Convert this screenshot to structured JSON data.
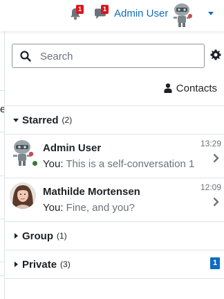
{
  "navbar": {
    "notification_count": "1",
    "message_count": "1",
    "user_name": "Admin User"
  },
  "drawer": {
    "search": {
      "placeholder": "Search",
      "value": ""
    },
    "contacts_label": "Contacts",
    "page_glyph": "e",
    "sections": {
      "starred": {
        "label": "Starred",
        "count": "(2)",
        "conversations": [
          {
            "name": "Admin User",
            "prefix": "You:",
            "message": "This is a self-conversation 1",
            "time": "13:29",
            "status": "online"
          },
          {
            "name": "Mathilde Mortensen",
            "prefix": "You:",
            "message": "Fine, and you?",
            "time": "12:09"
          }
        ]
      },
      "group": {
        "label": "Group",
        "count": "(1)"
      },
      "private": {
        "label": "Private",
        "count": "(3)",
        "unread": "1"
      }
    }
  },
  "colors": {
    "accent": "#0f6cbf",
    "badge_red": "#d9161c",
    "online": "#357a32",
    "muted_text": "#6a737b",
    "border": "#dee2e6"
  },
  "icons": [
    "bell-icon",
    "chat-icon",
    "search-icon",
    "gear-icon",
    "user-icon",
    "chevron-right-icon",
    "caret-down-icon",
    "caret-right-icon"
  ]
}
